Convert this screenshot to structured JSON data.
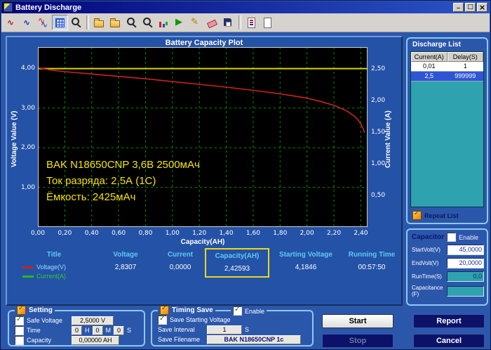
{
  "window": {
    "title": "Battery Discharge",
    "controls": [
      {
        "name": "minimize",
        "glyph": "minimize"
      },
      {
        "name": "maximize",
        "glyph": "maximize"
      },
      {
        "name": "close",
        "glyph": "close"
      }
    ]
  },
  "toolbar": {
    "icons": [
      {
        "name": "plot-red-curve",
        "glyph": "wave-red"
      },
      {
        "name": "plot-blue-curve",
        "glyph": "wave-blue"
      },
      {
        "name": "plot-dual-curve",
        "glyph": "wave-dual"
      },
      {
        "name": "pan-grid",
        "glyph": "grid",
        "pressed": true
      },
      {
        "name": "zoom-window",
        "glyph": "magnifier-plus"
      },
      {
        "name": "open-file",
        "glyph": "folder",
        "gap_before": true
      },
      {
        "name": "open-data",
        "glyph": "folder"
      },
      {
        "name": "zoom-in",
        "glyph": "magnifier-plus"
      },
      {
        "name": "zoom-out",
        "glyph": "magnifier-minus"
      },
      {
        "name": "chart-view",
        "glyph": "chart-bars"
      },
      {
        "name": "start-run",
        "glyph": "play"
      },
      {
        "name": "edit-pencil",
        "glyph": "pencil"
      },
      {
        "name": "erase",
        "glyph": "eraser"
      },
      {
        "name": "save-data",
        "glyph": "floppy"
      },
      {
        "name": "report-doc",
        "glyph": "doc-red",
        "gap_before": true
      },
      {
        "name": "print-doc",
        "glyph": "doc"
      }
    ]
  },
  "chart": {
    "title": "Battery Capacity Plot",
    "y_left_label": "Voltage Value (V)",
    "y_right_label": "Current Value (A)",
    "x_label": "Capacity(AH)",
    "annotation": [
      "BAK N18650CNP 3,6В 2500мАч",
      "Ток разряда: 2,5А (1С)",
      "Ёмкость: 2425мАч"
    ]
  },
  "chart_data": {
    "type": "line",
    "title": "Battery Capacity Plot",
    "xlabel": "Capacity(AH)",
    "ylabel_left": "Voltage Value (V)",
    "ylabel_right": "Current Value (A)",
    "x_range": [
      0,
      2.45
    ],
    "y_left_range": [
      0,
      4.54
    ],
    "y_right_range": [
      0,
      2.84
    ],
    "grid": true,
    "grid_color": "#00a400",
    "x_tick_values": [
      0,
      0.2,
      0.4,
      0.6,
      0.8,
      1.0,
      1.2,
      1.4,
      1.6,
      1.8,
      2.0,
      2.2,
      2.4
    ],
    "x_tick_labels": [
      "0,00",
      "0,20",
      "0,40",
      "0,60",
      "0,80",
      "1,00",
      "1,20",
      "1,40",
      "1,60",
      "1,80",
      "2,00",
      "2,20",
      "2,40"
    ],
    "y_left_tick_values": [
      4,
      3,
      2,
      1
    ],
    "y_left_tick_labels": [
      "4,00",
      "3,00",
      "2,00",
      "1,00"
    ],
    "y_right_tick_values": [
      2.5,
      2.0,
      1.5,
      1.0,
      0.5
    ],
    "y_right_tick_labels": [
      "2,50",
      "2,00",
      "1,50",
      "1,00",
      "0,50"
    ],
    "series": [
      {
        "name": "Voltage(V)",
        "axis": "left",
        "color": "#cc2222",
        "points": [
          [
            0,
            4.02
          ],
          [
            0.1,
            3.96
          ],
          [
            0.2,
            3.92
          ],
          [
            0.4,
            3.86
          ],
          [
            0.6,
            3.8
          ],
          [
            0.8,
            3.74
          ],
          [
            1.0,
            3.67
          ],
          [
            1.2,
            3.6
          ],
          [
            1.4,
            3.53
          ],
          [
            1.6,
            3.45
          ],
          [
            1.8,
            3.36
          ],
          [
            1.9,
            3.31
          ],
          [
            2.0,
            3.25
          ],
          [
            2.1,
            3.17
          ],
          [
            2.2,
            3.07
          ],
          [
            2.25,
            3.0
          ],
          [
            2.3,
            2.92
          ],
          [
            2.35,
            2.8
          ],
          [
            2.38,
            2.7
          ],
          [
            2.4,
            2.6
          ],
          [
            2.415,
            2.5
          ],
          [
            2.422,
            2.44
          ],
          [
            2.4259,
            2.38
          ]
        ]
      },
      {
        "name": "Current(A)",
        "axis": "right",
        "color": "#d4d400",
        "points": [
          [
            0,
            2.5
          ],
          [
            2.45,
            2.5
          ]
        ]
      }
    ]
  },
  "stats": {
    "headers": [
      "Title",
      "Voltage",
      "Current",
      "Capacity(AH)",
      "Starting Voltage",
      "Running Time"
    ],
    "legend": [
      {
        "label": "Voltage(V)",
        "color": "#cc2222",
        "text_color": "#9bdcff"
      },
      {
        "label": "Current(A)",
        "color": "#22bb22",
        "text_color": "#30cc30"
      }
    ],
    "values": {
      "voltage": "2,8307",
      "current": "0,0000",
      "capacity": "2,42593",
      "starting_voltage": "4,1846",
      "running_time": "00:57:50"
    },
    "highlight_color": "#ead81a"
  },
  "discharge_list": {
    "title": "Discharge List",
    "columns": [
      "Current(A)",
      "Delay(S)"
    ],
    "rows": [
      [
        "0,01",
        "1"
      ],
      [
        "2,5",
        "999999"
      ]
    ],
    "selected_row_index": 1,
    "selection_color": "#2f55d4",
    "repeat_label": "Repeat List"
  },
  "capacitor": {
    "title": "Capacitor",
    "enable_label": "Enable",
    "enable_checked": false,
    "fields": [
      {
        "label": "StartVolt(V)",
        "value": "45,0000",
        "enabled": true
      },
      {
        "label": "EndVolt(V)",
        "value": "20,0000",
        "enabled": true
      },
      {
        "label": "RunTime(S)",
        "value": "0,0",
        "enabled": false
      },
      {
        "label": "Capacitance (F)",
        "value": "",
        "enabled": false
      }
    ]
  },
  "setting": {
    "title": "Setting",
    "safe_voltage": {
      "label": "Safe Voltage",
      "checked": true,
      "value": "2,5000 V"
    },
    "time": {
      "label": "Time",
      "checked": false,
      "h": "0",
      "h_label": "H",
      "m": "0",
      "m_label": "M",
      "s": "0",
      "s_label": "S"
    },
    "capacity": {
      "label": "Capacity",
      "checked": false,
      "value": "0,00000 AH"
    }
  },
  "timing_save": {
    "title": "Timing Save",
    "enable_label": "Enable",
    "enable_checked": true,
    "save_starting_voltage_label": "Save Starting Voltage",
    "save_starting_voltage_checked": true,
    "save_interval_label": "Save Interval",
    "save_interval_value": "1",
    "save_interval_unit": "S",
    "save_filename_label": "Save Filename",
    "save_filename_value": "BAK N18650CNP 1c"
  },
  "buttons": {
    "start": "Start",
    "report": "Report",
    "stop": "Stop",
    "cancel": "Cancel"
  }
}
